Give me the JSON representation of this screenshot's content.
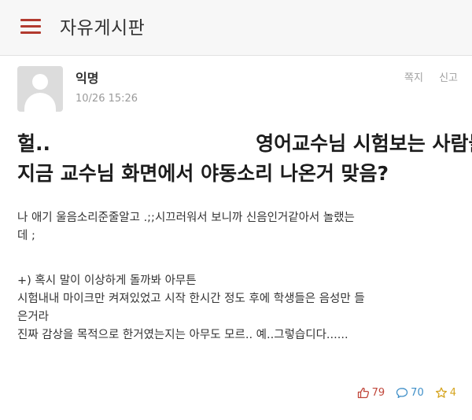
{
  "header": {
    "board_title": "자유게시판"
  },
  "post": {
    "author": "익명",
    "timestamp": "10/26 15:26",
    "actions": {
      "message": "쪽지",
      "report": "신고"
    },
    "title_line1": "헐..                              영어교수님 시험보는 사람들",
    "title_line2": "지금 교수님 화면에서 야동소리 나온거 맞음?",
    "body_line1": "나 애기 울음소리준줄알고 .;;시끄러워서 보니까 신음인거같아서          놀랬는",
    "body_line2": "데 ;",
    "body_line3": "+) 혹시 말이 이상하게 돌까봐 아무튼",
    "body_line4": "시험내내 마이크만 켜져있었고 시작 한시간 정도 후에 학생들은 음성만 들",
    "body_line5": "은거라",
    "body_line6": "진짜 감상을 목적으로 한거였는지는 아무도 모르.. 예..그렇습디다......",
    "stats": {
      "likes": "79",
      "comments": "70",
      "scraps": "4"
    }
  },
  "colors": {
    "like": "#c0463a",
    "comment": "#3f8fc8",
    "scrap": "#d6a521",
    "menu": "#b23a2f"
  }
}
